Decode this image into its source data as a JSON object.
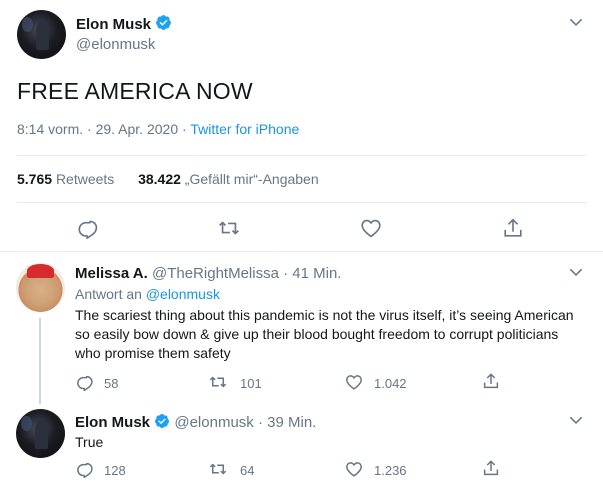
{
  "main_tweet": {
    "author_name": "Elon Musk",
    "author_handle": "@elonmusk",
    "text": "FREE AMERICA NOW",
    "time": "8:14 vorm.",
    "separator": "·",
    "date": "29. Apr. 2020",
    "source": "Twitter for iPhone",
    "retweets_count": "5.765",
    "retweets_label": "Retweets",
    "likes_count": "38.422",
    "likes_label": "„Gefällt mir“-Angaben",
    "icons": [
      "reply-icon",
      "retweet-icon",
      "like-icon",
      "share-icon"
    ]
  },
  "replies": [
    {
      "author_name": "Melissa A.",
      "author_handle": "@TheRightMelissa",
      "separator": "·",
      "time": "41 Min.",
      "reply_prefix": "Antwort an",
      "reply_to": "@elonmusk",
      "text": "The scariest thing about this pandemic is not the virus itself, it’s seeing American so easily bow down & give up their blood bought freedom to corrupt politicians who promise them safety",
      "reply_count": "58",
      "retweet_count": "101",
      "like_count": "1.042"
    },
    {
      "author_name": "Elon Musk",
      "author_handle": "@elonmusk",
      "separator": "·",
      "time": "39 Min.",
      "text": "True",
      "reply_count": "128",
      "retweet_count": "64",
      "like_count": "1.236"
    }
  ],
  "colors": {
    "verified_blue": "#1da1f2",
    "link_blue": "#1b95e0",
    "secondary_text": "#657786",
    "divider": "#e6ecf0",
    "icon_gray": "#657786"
  }
}
